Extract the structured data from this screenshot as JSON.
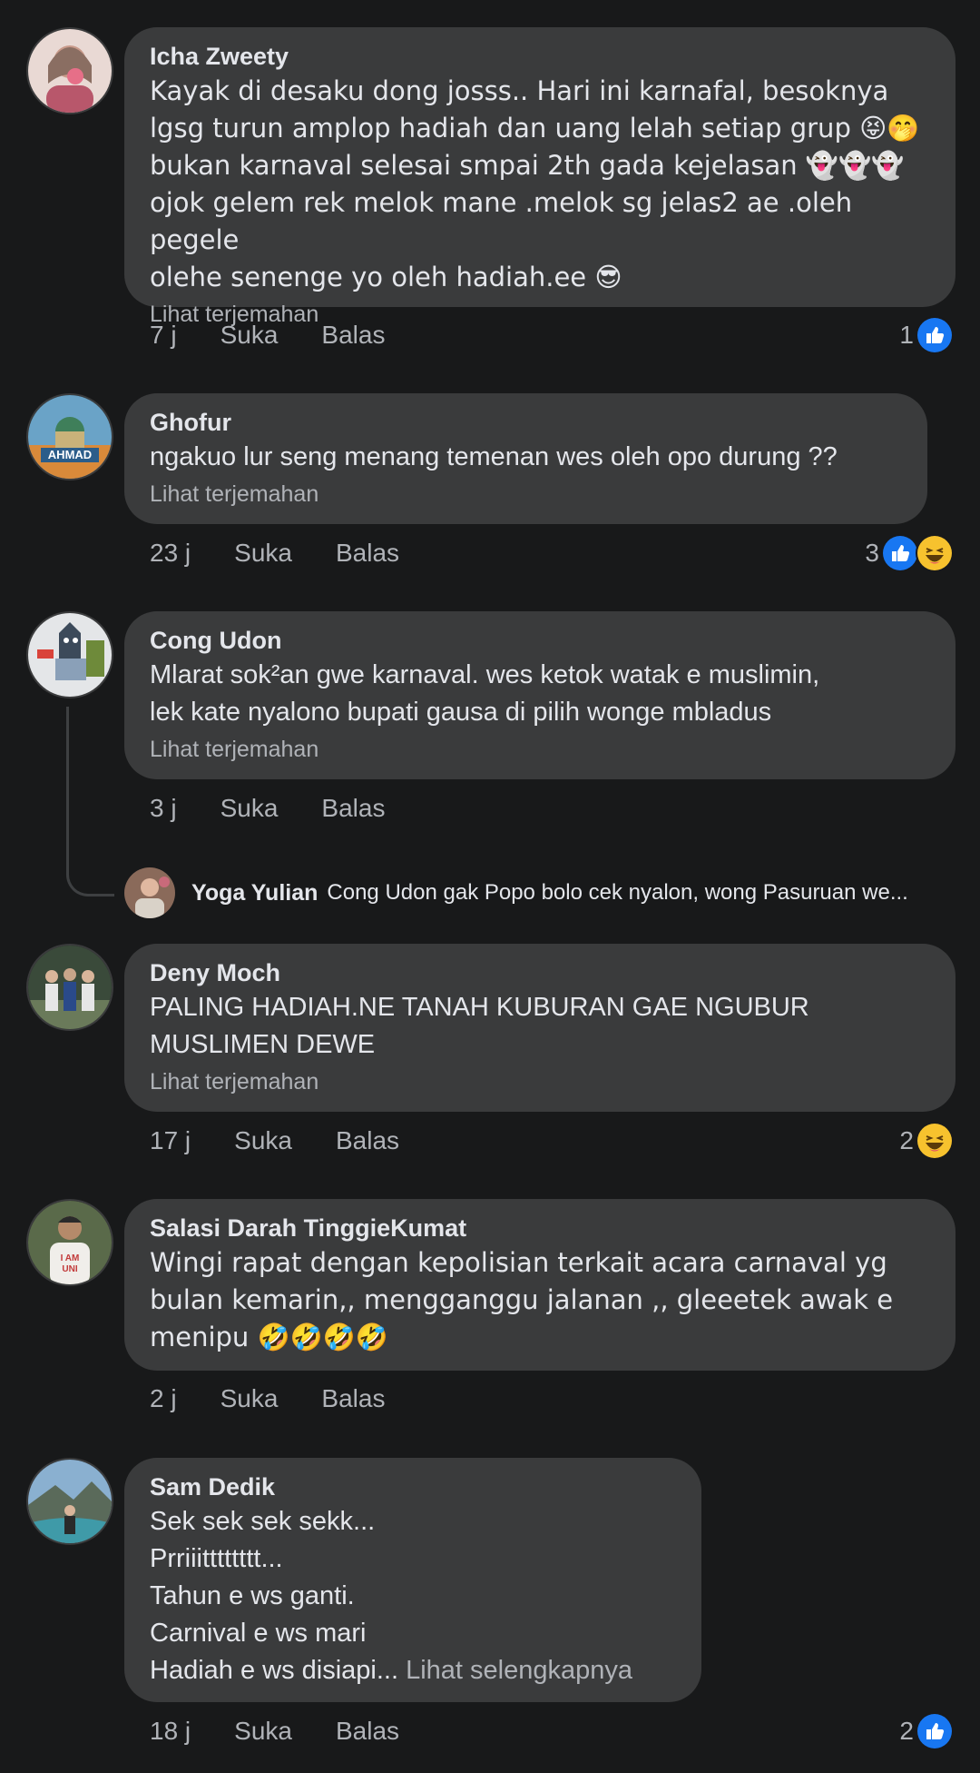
{
  "comments": [
    {
      "name": "Icha Zweety",
      "text": "Kayak di desaku dong josss.. Hari ini karnafal, besoknya\nlgsg turun amplop hadiah dan uang lelah setiap grup 😝🤭\nbukan karnaval selesai smpai 2th gada kejelasan 👻👻👻\nojok gelem rek melok mane .melok sg jelas2 ae .oleh pegele\nolehe senenge yo oleh hadiah.ee 😎",
      "translate": "Lihat terjemahan",
      "time": "7 j",
      "like": "Suka",
      "reply": "Balas",
      "react_count": "1",
      "reactions": [
        "like-icon"
      ]
    },
    {
      "name": "Ghofur",
      "text": "ngakuo lur seng menang temenan wes oleh opo durung ??",
      "translate": "Lihat terjemahan",
      "time": "23 j",
      "like": "Suka",
      "reply": "Balas",
      "react_count": "3",
      "reactions": [
        "like-icon",
        "haha-icon"
      ]
    },
    {
      "name": "Cong Udon",
      "text": "Mlarat sok²an gwe karnaval. wes ketok watak e muslimin,\nlek kate nyalono bupati gausa di pilih wonge mbladus",
      "translate": "Lihat terjemahan",
      "time": "3 j",
      "like": "Suka",
      "reply": "Balas",
      "reply_preview": {
        "name": "Yoga Yulian",
        "text": "Cong Udon gak Popo bolo cek nyalon, wong Pasuruan we..."
      }
    },
    {
      "name": "Deny Moch",
      "text": "PALING HADIAH.NE TANAH KUBURAN GAE NGUBUR\nMUSLIMEN  DEWE",
      "translate": "Lihat terjemahan",
      "time": "17 j",
      "like": "Suka",
      "reply": "Balas",
      "react_count": "2",
      "reactions": [
        "haha-icon"
      ]
    },
    {
      "name": "Salasi Darah TinggieKumat",
      "text": "Wingi rapat dengan kepolisian terkait acara carnaval yg\nbulan kemarin,, mengganggu jalanan ,, gleeetek awak e\nmenipu 🤣🤣🤣🤣",
      "time": "2 j",
      "like": "Suka",
      "reply": "Balas"
    },
    {
      "name": "Sam Dedik",
      "text": "Sek sek sek sekk...\nPrriiitttttttt...\nTahun e ws ganti.\nCarnival e ws mari\nHadiah e ws disiapi...",
      "see_more": "Lihat selengkapnya",
      "time": "18 j",
      "like": "Suka",
      "reply": "Balas",
      "react_count": "2",
      "reactions": [
        "like-icon"
      ]
    }
  ]
}
